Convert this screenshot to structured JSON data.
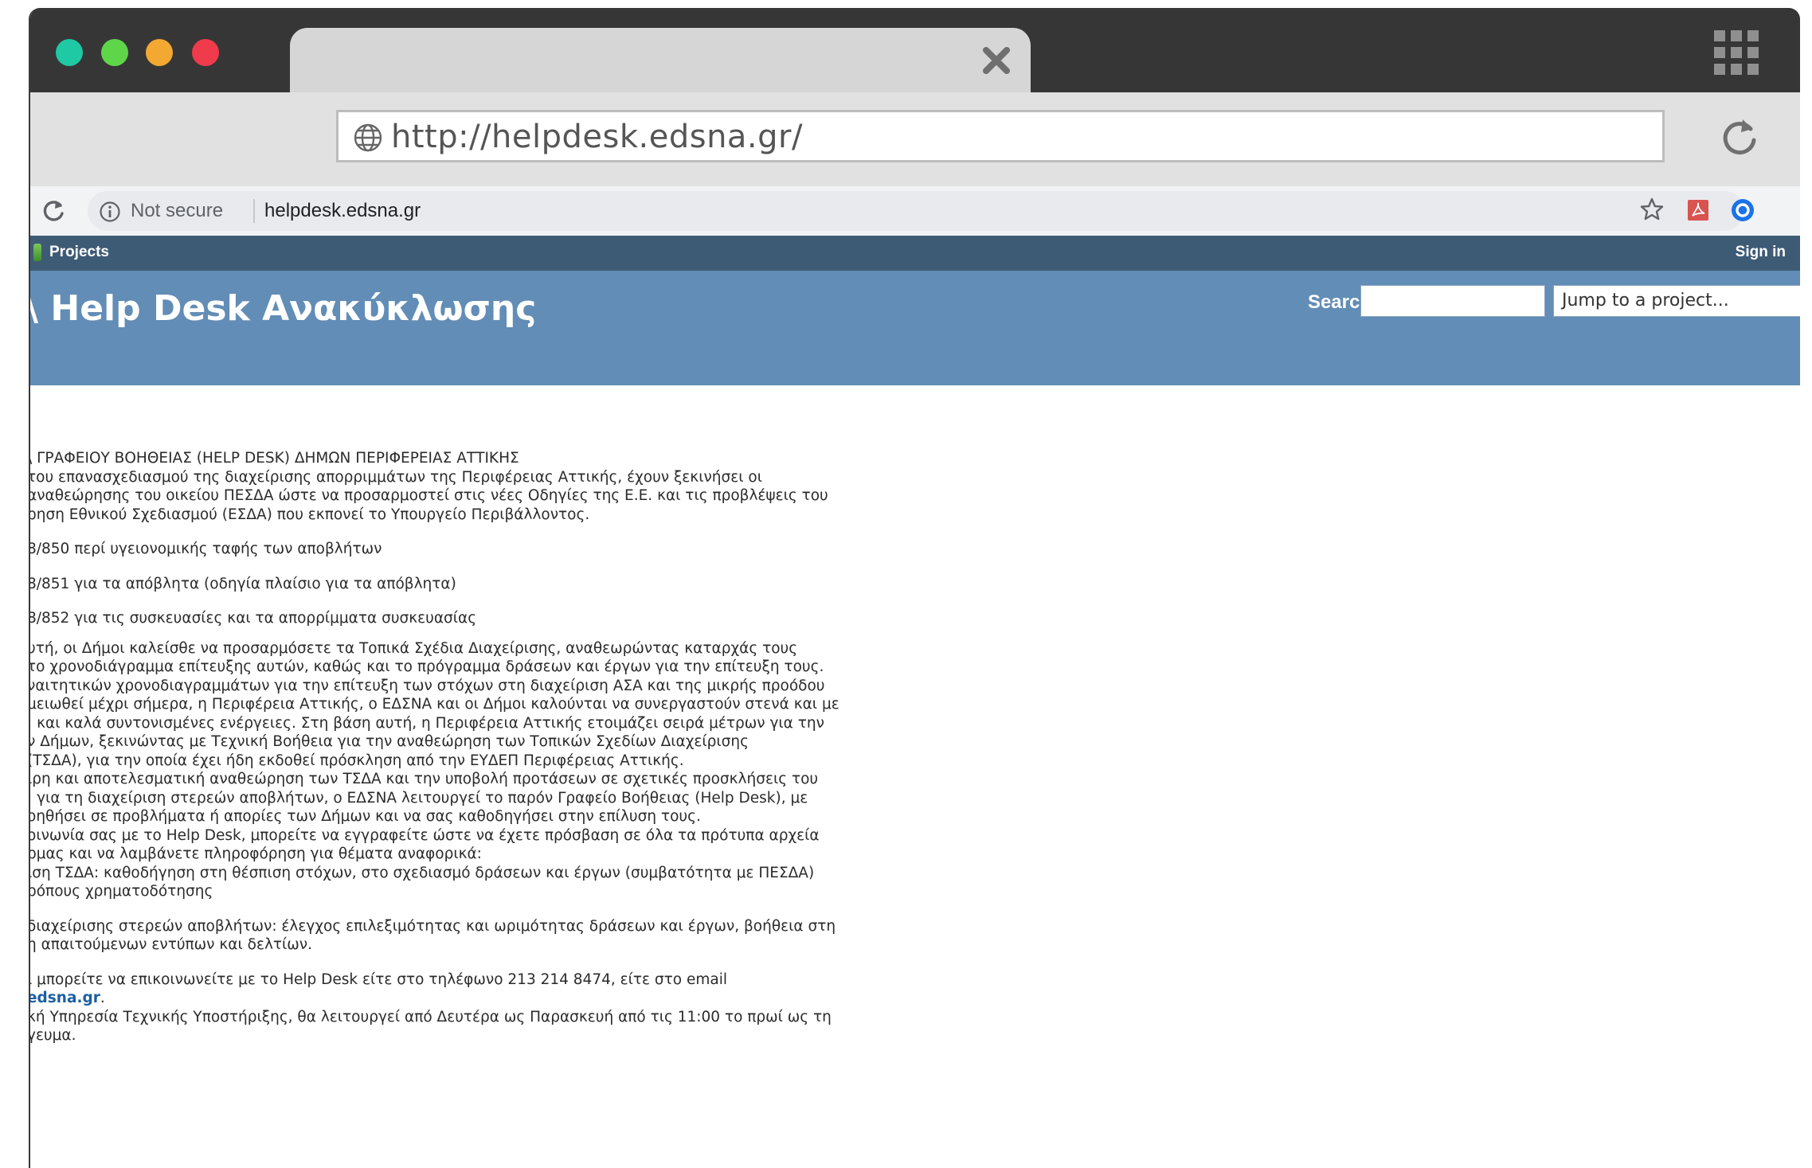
{
  "mockup": {
    "url": "http://helpdesk.edsna.gr/"
  },
  "chrome": {
    "security": "Not secure",
    "url": "helpdesk.edsna.gr"
  },
  "topmenu": {
    "projects": "Projects",
    "signin": "Sign in"
  },
  "header": {
    "title": "\\ Help Desk Ανακύκλωσης",
    "search_label": "Search:",
    "jump_placeholder": "Jump to a project..."
  },
  "content": {
    "heading": "\\ ΓΡΑΦΕΙΟΥ ΒΟΗΘΕΙΑΣ (HELP DESK) ΔΗΜΩΝ ΠΕΡΙΦΕΡΕΙΑΣ ΑΤΤΙΚΗΣ",
    "intro": [
      "του επανασχεδιασμού της διαχείρισης απορριμμάτων της Περιφέρειας Αττικής, έχουν ξεκινήσει οι",
      "αναθεώρησης του οικείου ΠΕΣΔΑ ώστε να προσαρμοστεί στις νέες Οδηγίες της Ε.Ε. και τις προβλέψεις του",
      "ρηση Εθνικού Σχεδιασμού (ΕΣΔΑ) που εκπονεί το Υπουργείο Περιβάλλοντος."
    ],
    "directives": [
      "8/850 περί υγειονομικής ταφής των αποβλήτων",
      "8/851 για τα απόβλητα (οδηγία πλαίσιο για τα απόβλητα)",
      "8/852 για τις συσκευασίες και τα απορρίμματα συσκευασίας"
    ],
    "body": [
      "υτή, οι Δήμοι καλείσθε να προσαρμόσετε τα Τοπικά Σχέδια Διαχείρισης, αναθεωρώντας καταρχάς τους",
      "το χρονοδιάγραμμα επίτευξης αυτών, καθώς και το πρόγραμμα δράσεων και έργων για την επίτευξη τους.",
      "ναιτητικών χρονοδιαγραμμάτων για την επίτευξη των στόχων στη διαχείριση ΑΣΑ και της μικρής προόδου",
      "μειωθεί μέχρι σήμερα, η Περιφέρεια Αττικής, ο ΕΔΣΝΑ και οι Δήμοι καλούνται να συνεργαστούν στενά και με",
      "; και καλά συντονισμένες ενέργειες. Στη βάση αυτή, η Περιφέρεια Αττικής ετοιμάζει σειρά μέτρων για την",
      "ν Δήμων, ξεκινώντας με Τεχνική Βοήθεια για την αναθεώρηση των Τοπικών Σχεδίων Διαχείρισης",
      "(ΤΣΔΑ), για την οποία έχει ήδη εκδοθεί πρόσκληση από την ΕΥΔΕΠ Περιφέρειας Αττικής.",
      "ιρη και αποτελεσματική αναθεώρηση των ΤΣΔΑ και την υποβολή προτάσεων σε σχετικές προσκλήσεις του",
      "; για τη διαχείριση στερεών αποβλήτων, ο ΕΔΣΝΑ λειτουργεί το παρόν Γραφείο Βοήθειας (Help Desk), με",
      "οηθήσει σε προβλήματα ή απορίες των Δήμων και να σας καθοδηγήσει στην επίλυση τους.",
      "οινωνία σας με το Help Desk, μπορείτε να εγγραφείτε ώστε να έχετε πρόσβαση σε όλα τα πρότυπα αρχεία",
      "ρμας και να λαμβάνετε πληροφόρηση για θέματα αναφορικά:",
      "ιση ΤΣΔΑ: καθοδήγηση στη θέσπιση στόχων, στο σχεδιασμό δράσεων και έργων (συμβατότητα με ΠΕΣΔΑ)",
      "ρόπους χρηματοδότησης"
    ],
    "body2": [
      "διαχείρισης στερεών αποβλήτων: έλεγχος επιλεξιμότητας και ωριμότητας δράσεων και έργων, βοήθεια στη",
      "η απαιτούμενων εντύπων και δελτίων."
    ],
    "contact": "ι μπορείτε να επικοινωνείτε με το Help Desk είτε στο τηλέφωνο 213 214 8474, είτε στο email",
    "email": "edsna.gr",
    "email_suffix": ".",
    "hours": [
      "κή Υπηρεσία Τεχνικής Υποστήριξης, θα λειτουργεί από Δευτέρα ως Παρασκευή από τις 11:00 το πρωί ως τη",
      "γευμα."
    ]
  }
}
